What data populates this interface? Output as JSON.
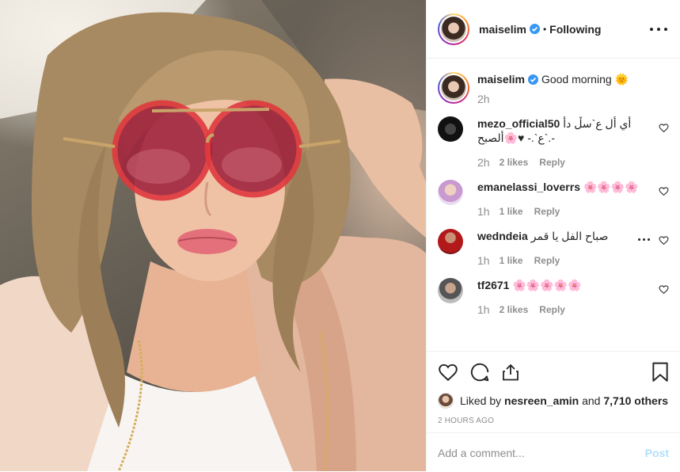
{
  "header": {
    "username": "maiselim",
    "separator": "•",
    "follow_label": "Following"
  },
  "caption": {
    "username": "maiselim",
    "text": "Good morning 🌞",
    "time": "2h"
  },
  "comments": [
    {
      "username": "mezo_official50",
      "text": "أي أل ع`سڵ دأ ع`.- ♥🌸ألصبح`.-",
      "time": "2h",
      "likes": "2 likes",
      "reply": "Reply"
    },
    {
      "username": "emanelassi_loverrs",
      "text": "🌸🌸🌸🌸",
      "time": "1h",
      "likes": "1 like",
      "reply": "Reply"
    },
    {
      "username": "wedndeia",
      "text": "صباح الفل يا قمر",
      "time": "1h",
      "likes": "1 like",
      "reply": "Reply"
    },
    {
      "username": "tf2671",
      "text": "🌸🌸🌸🌸🌸",
      "time": "1h",
      "likes": "2 likes",
      "reply": "Reply"
    }
  ],
  "likes": {
    "prefix": "Liked by",
    "user": "nesreen_amin",
    "middle": "and",
    "others": "7,710 others"
  },
  "posted_ago": "2 HOURS AGO",
  "composer": {
    "placeholder": "Add a comment...",
    "post_label": "Post"
  },
  "colors": {
    "verified_blue": "#3897f0",
    "post_button_disabled": "#b2dffc",
    "meta_gray": "#8e8e8e"
  },
  "icons": [
    "verified-icon",
    "more-options-icon",
    "heart-icon",
    "comment-icon",
    "share-icon",
    "bookmark-icon"
  ]
}
